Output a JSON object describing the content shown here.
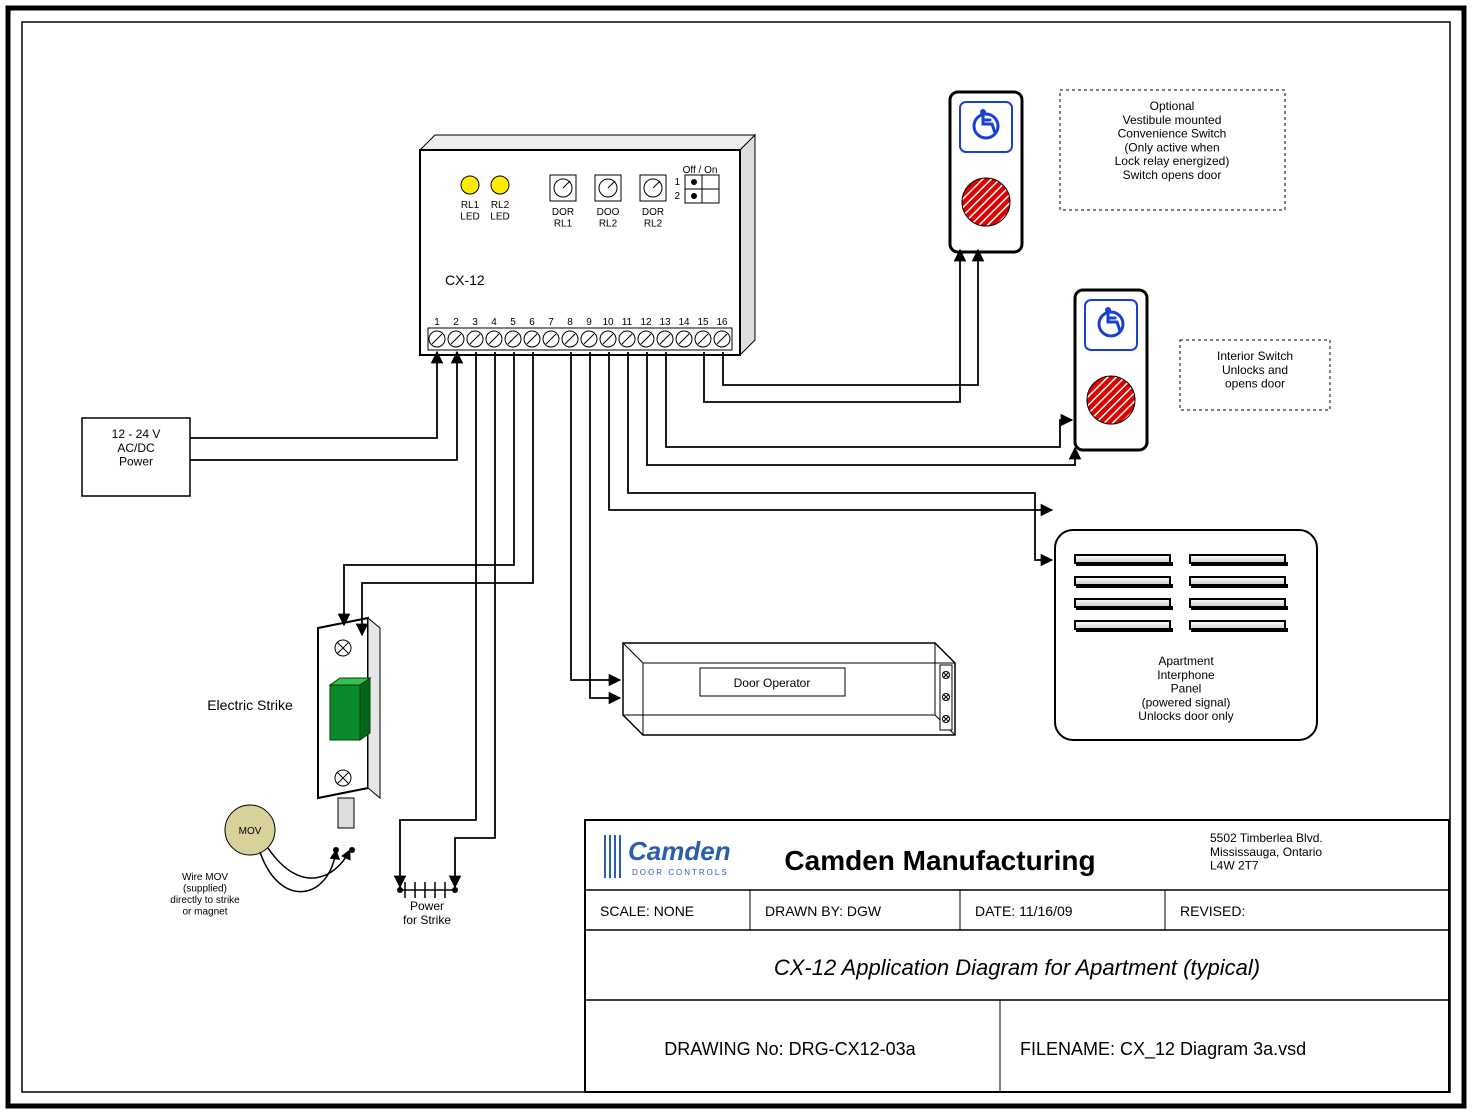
{
  "controller": {
    "label": "CX-12",
    "leds": [
      "RL1\nLED",
      "RL2\nLED"
    ],
    "pots": [
      "DOR\nRL1",
      "DOO\nRL2",
      "DOR\nRL2"
    ],
    "dip": {
      "header": "Off / On",
      "rows": [
        "1",
        "2"
      ]
    },
    "terminals": [
      "1",
      "2",
      "3",
      "4",
      "5",
      "6",
      "7",
      "8",
      "9",
      "10",
      "11",
      "12",
      "13",
      "14",
      "15",
      "16"
    ]
  },
  "power": {
    "label": "12 - 24 V\nAC/DC\nPower"
  },
  "door_operator": {
    "label": "Door Operator"
  },
  "strike": {
    "label": "Electric Strike",
    "power": "Power\nfor Strike"
  },
  "mov": {
    "label": "MOV",
    "note": "Wire MOV\n(supplied)\ndirectly to strike\nor magnet"
  },
  "interphone": {
    "label": "Apartment\nInterphone\nPanel\n(powered signal)\nUnlocks door only"
  },
  "switch_optional": {
    "note": "Optional\nVestibule mounted\nConvenience Switch\n(Only active when\nLock relay energized)\nSwitch opens door"
  },
  "switch_interior": {
    "note": "Interior Switch\nUnlocks and\nopens door"
  },
  "titleblock": {
    "company": "Camden Manufacturing",
    "address": "5502 Timberlea Blvd.\nMississauga, Ontario\nL4W 2T7",
    "scale": "SCALE:  NONE",
    "drawn": "DRAWN BY: DGW",
    "date": "DATE:  11/16/09",
    "revised": "REVISED:",
    "title": "CX-12 Application Diagram for Apartment (typical)",
    "drawing_no": "DRAWING No: DRG-CX12-03a",
    "filename": "FILENAME:    CX_12 Diagram 3a.vsd",
    "logo_top": "Camden",
    "logo_sub": "DOOR CONTROLS"
  }
}
